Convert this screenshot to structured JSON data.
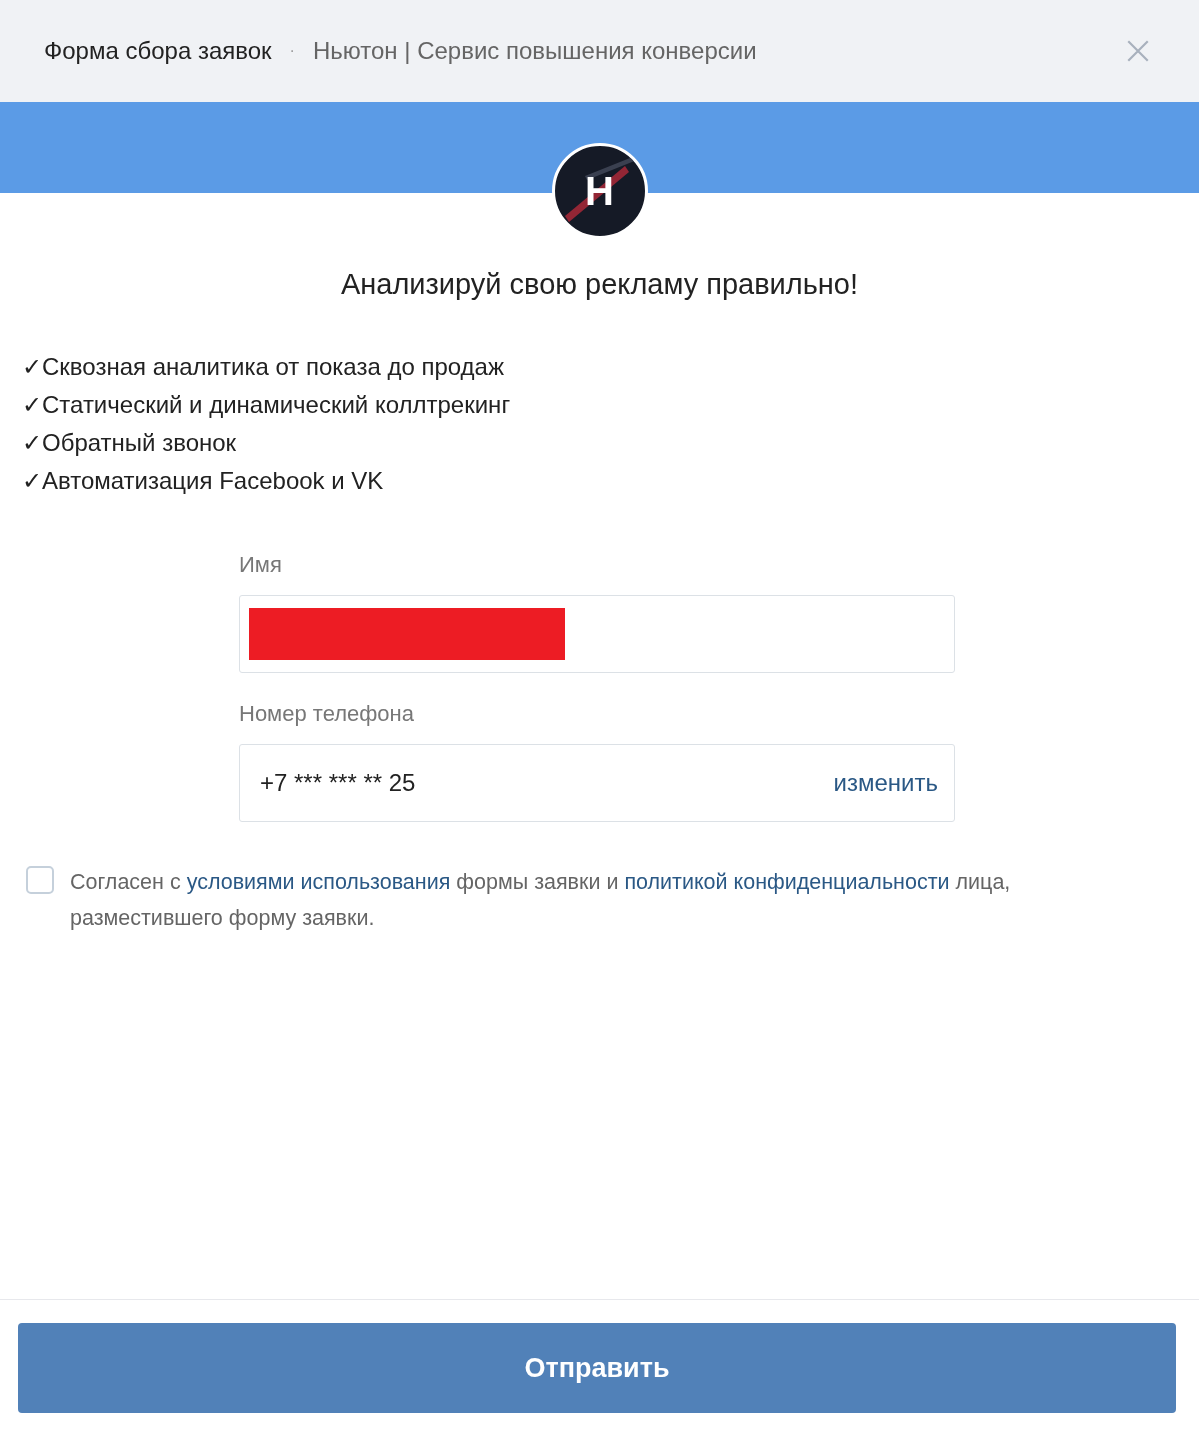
{
  "header": {
    "title": "Форма сбора заявок",
    "separator": "·",
    "subtitle": "Ньютон | Сервис повышения конверсии"
  },
  "logo": {
    "letter": "Н"
  },
  "heading": "Анализируй свою рекламу правильно!",
  "features": [
    "✓Сквозная аналитика от показа до продаж",
    "✓Статический и динамический коллтрекинг",
    "✓Обратный звонок",
    "✓Автоматизация Facebook и VK"
  ],
  "fields": [
    {
      "label": "Имя",
      "redacted": true
    },
    {
      "label": "Номер телефона",
      "value": "+7 *** *** ** 25",
      "action": "изменить"
    }
  ],
  "consent": {
    "checked": false,
    "parts": [
      {
        "kind": "text",
        "text": "Согласен с "
      },
      {
        "kind": "link",
        "text": "условиями использования"
      },
      {
        "kind": "text",
        "text": " формы заявки и "
      },
      {
        "kind": "link",
        "text": "политикой конфиденциальности"
      },
      {
        "kind": "text",
        "text": " лица, разместившего форму заявки."
      }
    ]
  },
  "submit": "Отправить"
}
